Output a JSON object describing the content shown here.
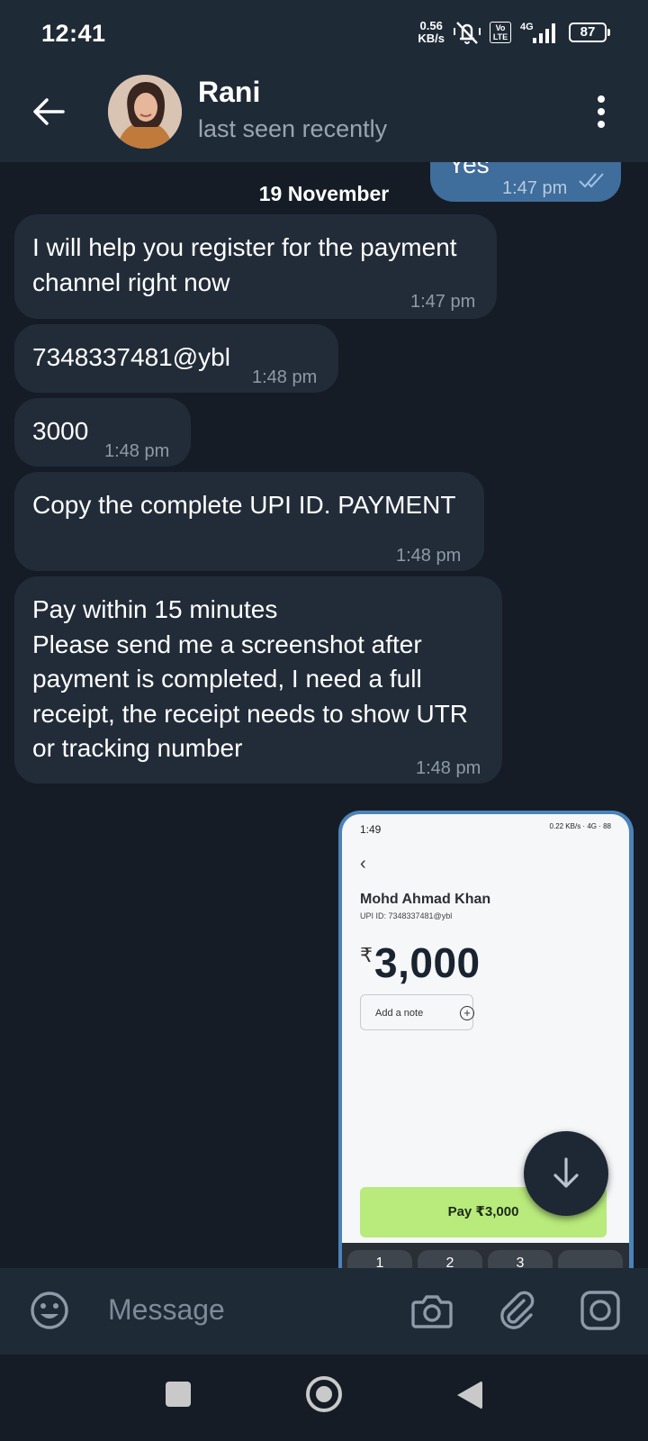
{
  "status_bar": {
    "time": "12:41",
    "speed_value": "0.56",
    "speed_unit": "KB/s",
    "volte": "Vo\nLTE",
    "network": "4G",
    "battery": "87"
  },
  "header": {
    "contact_name": "Rani",
    "contact_status": "last seen recently"
  },
  "chat": {
    "date_chip": "19 November",
    "outgoing": {
      "text": "Yes",
      "time": "1:47 pm"
    },
    "messages": [
      {
        "text": "I will help you register for the payment\nchannel right now",
        "time": "1:47 pm"
      },
      {
        "text": "7348337481@ybl",
        "time": "1:48 pm"
      },
      {
        "text": "3000",
        "time": "1:48 pm"
      },
      {
        "text": "Copy the complete UPI ID.  PAYMENT",
        "time": "1:48 pm"
      },
      {
        "text": "Pay within 15 minutes\nPlease send me a screenshot after\npayment is completed, I need a full\nreceipt, the receipt needs to show UTR\nor tracking number",
        "time": "1:48 pm"
      }
    ],
    "screenshot": {
      "time": "1:49",
      "status_right": "0.22 KB/s · 4G · 88",
      "payee_name": "Mohd Ahmad Khan",
      "upi_line": "UPI ID: 7348337481@ybl",
      "currency": "₹",
      "amount": "3,000",
      "note_label": "Add a note",
      "note_plus": "+",
      "pay_button": "Pay ₹3,000",
      "keys": [
        "1",
        "2",
        "3",
        ""
      ]
    }
  },
  "input_bar": {
    "placeholder": "Message"
  },
  "colors": {
    "background": "#151c26",
    "header": "#1f2a37",
    "incoming_bubble": "#222c39",
    "outgoing_bubble": "#3f6d9c",
    "accent": "#4b82b9",
    "pay_button": "#b8ea7c"
  }
}
